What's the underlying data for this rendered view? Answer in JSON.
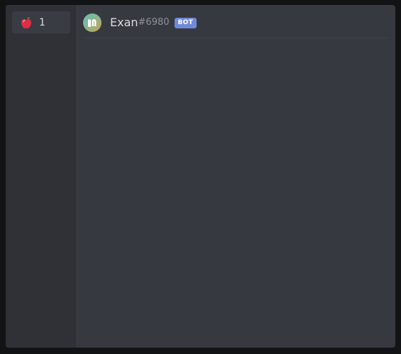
{
  "sidebar": {
    "items": [
      {
        "icon": "apple-icon",
        "count": "1"
      }
    ]
  },
  "member": {
    "avatar_icon": "exan-logo-icon",
    "username": "Exan",
    "discriminator": "#6980",
    "badge": "BOT"
  },
  "colors": {
    "background": "#36393f",
    "sidebar": "#2f3136",
    "badge": "#7289da"
  }
}
